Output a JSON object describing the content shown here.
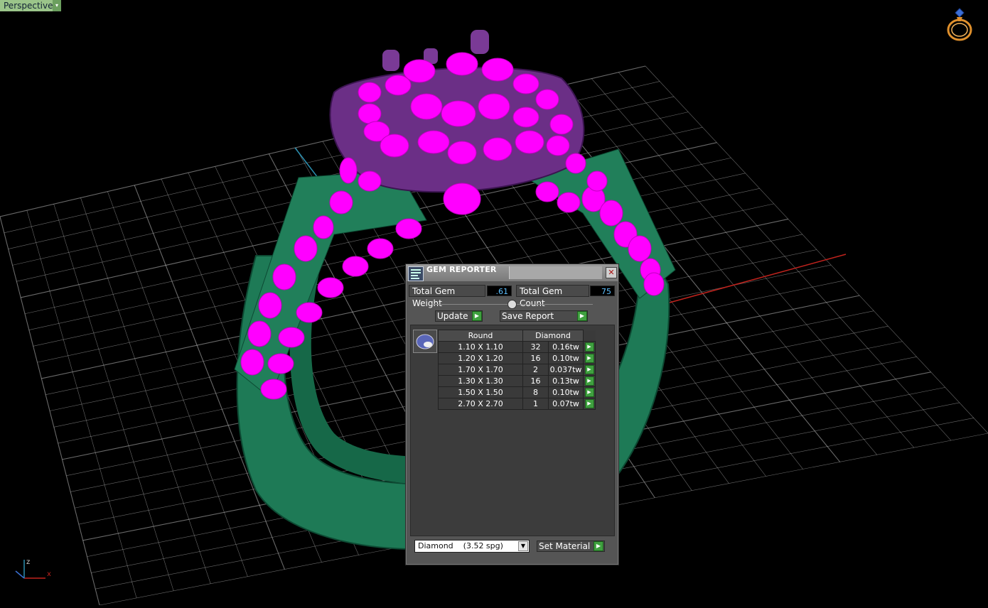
{
  "viewport": {
    "label": "Perspective",
    "dropdown_glyph": "▾",
    "axis_labels": {
      "x": "x",
      "z": "z"
    },
    "ring_icon": "ring-icon"
  },
  "dialog": {
    "title": "GEM REPORTER",
    "close_glyph": "✕",
    "total_weight_label": "Total Gem Weight",
    "total_weight_value": ".61",
    "total_count_label": "Total Gem Count",
    "total_count_value": "75",
    "update_label": "Update",
    "save_report_label": "Save Report",
    "play_glyph": "▶",
    "table": {
      "headers": [
        "Round",
        "Diamond"
      ],
      "rows": [
        {
          "size": "1.10 X 1.10",
          "count": "32",
          "weight": "0.16tw"
        },
        {
          "size": "1.20 X 1.20",
          "count": "16",
          "weight": "0.10tw"
        },
        {
          "size": "1.70 X 1.70",
          "count": "2",
          "weight": "0.037tw"
        },
        {
          "size": "1.30 X 1.30",
          "count": "16",
          "weight": "0.13tw"
        },
        {
          "size": "1.50 X 1.50",
          "count": "8",
          "weight": "0.10tw"
        },
        {
          "size": "2.70 X 2.70",
          "count": "1",
          "weight": "0.07tw"
        }
      ]
    },
    "material_select": "Diamond    (3.52 spg)",
    "set_material_label": "Set Material"
  },
  "colors": {
    "gem": "#ff00ff",
    "head": "#6b2f86",
    "shank": "#1d7b55",
    "grid": "#bfbfbf",
    "accent_green": "#3fa03f"
  }
}
